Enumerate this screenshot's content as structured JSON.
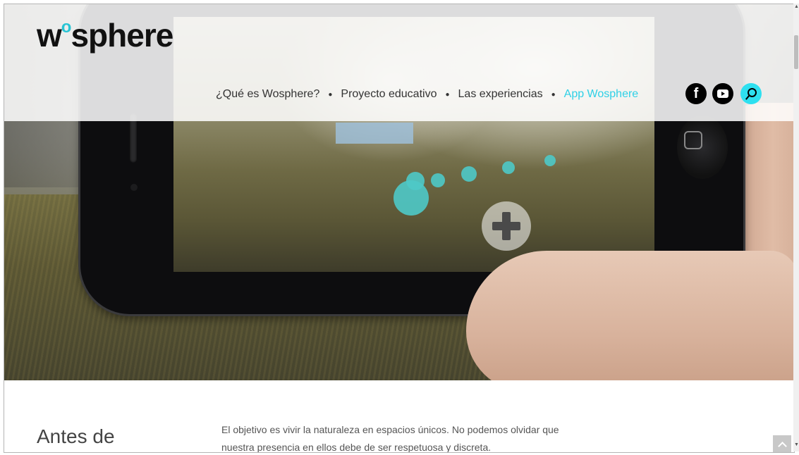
{
  "brand": {
    "logo_prefix": "w",
    "logo_circle": "o",
    "logo_suffix": "sphere",
    "accent_color": "#2ed0e6"
  },
  "nav": {
    "items": [
      {
        "label": "¿Qué es Wosphere?",
        "active": false
      },
      {
        "label": "Proyecto educativo",
        "active": false
      },
      {
        "label": "Las experiencias",
        "active": false
      },
      {
        "label": "App Wosphere",
        "active": true
      }
    ],
    "separator": "●"
  },
  "social": {
    "facebook_icon": "facebook-icon",
    "facebook_glyph": "f",
    "youtube_icon": "youtube-icon",
    "search_icon": "search-icon"
  },
  "content": {
    "title": "Antes de comenzar",
    "paragraph": "El objetivo es vivir la naturaleza en espacios únicos. No podemos olvidar que nuestra presencia en ellos debe de ser respetuosa y discreta."
  },
  "scroll": {
    "up_arrow": "▲",
    "down_arrow": "▼"
  }
}
